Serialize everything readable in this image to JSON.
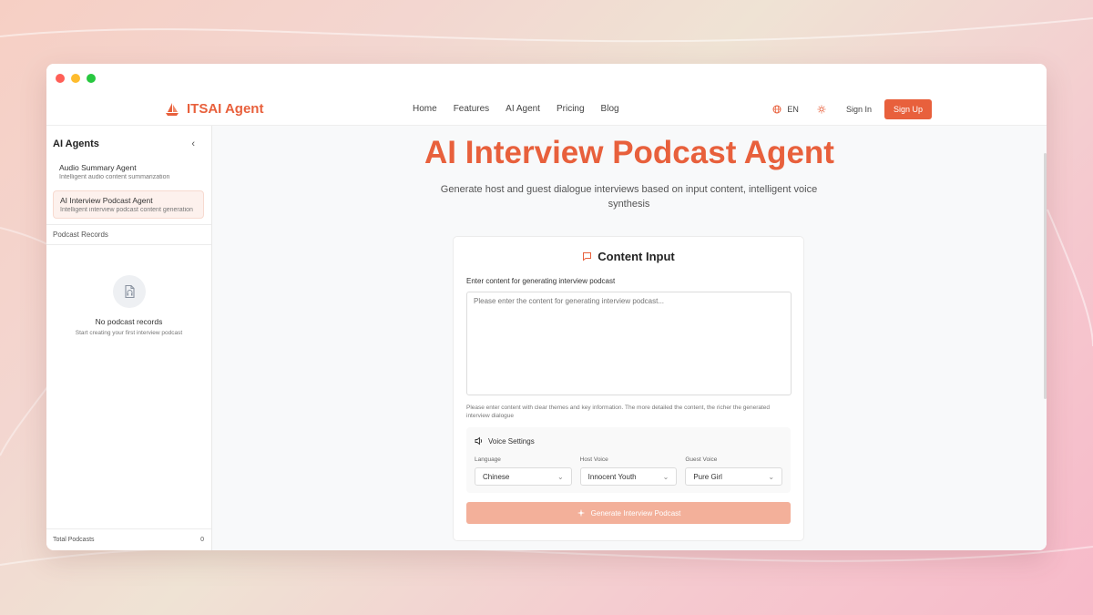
{
  "brand": {
    "name": "ITSAI Agent"
  },
  "nav": {
    "links": [
      "Home",
      "Features",
      "AI Agent",
      "Pricing",
      "Blog"
    ],
    "language": "EN",
    "signin": "Sign In",
    "signup": "Sign Up"
  },
  "sidebar": {
    "title": "AI Agents",
    "agents": [
      {
        "name": "Audio Summary Agent",
        "desc": "Intelligent audio content summarization"
      },
      {
        "name": "AI Interview Podcast Agent",
        "desc": "Intelligent interview podcast content generation"
      }
    ],
    "records_title": "Podcast Records",
    "empty_title": "No podcast records",
    "empty_sub": "Start creating your first interview podcast",
    "footer_label": "Total Podcasts",
    "footer_count": "0"
  },
  "main": {
    "title": "AI Interview Podcast Agent",
    "subtitle": "Generate host and guest dialogue interviews based on input content, intelligent voice synthesis",
    "card_title": "Content Input",
    "field_label": "Enter content for generating interview podcast",
    "placeholder": "Please enter the content for generating interview podcast...",
    "hint": "Please enter content with clear themes and key information. The more detailed the content, the richer the generated interview dialogue",
    "voice_title": "Voice Settings",
    "voice": [
      {
        "label": "Language",
        "value": "Chinese"
      },
      {
        "label": "Host Voice",
        "value": "Innocent Youth"
      },
      {
        "label": "Guest Voice",
        "value": "Pure Girl"
      }
    ],
    "generate": "Generate Interview Podcast"
  },
  "colors": {
    "accent": "#e8603c",
    "accent_light": "#f3b09a"
  }
}
